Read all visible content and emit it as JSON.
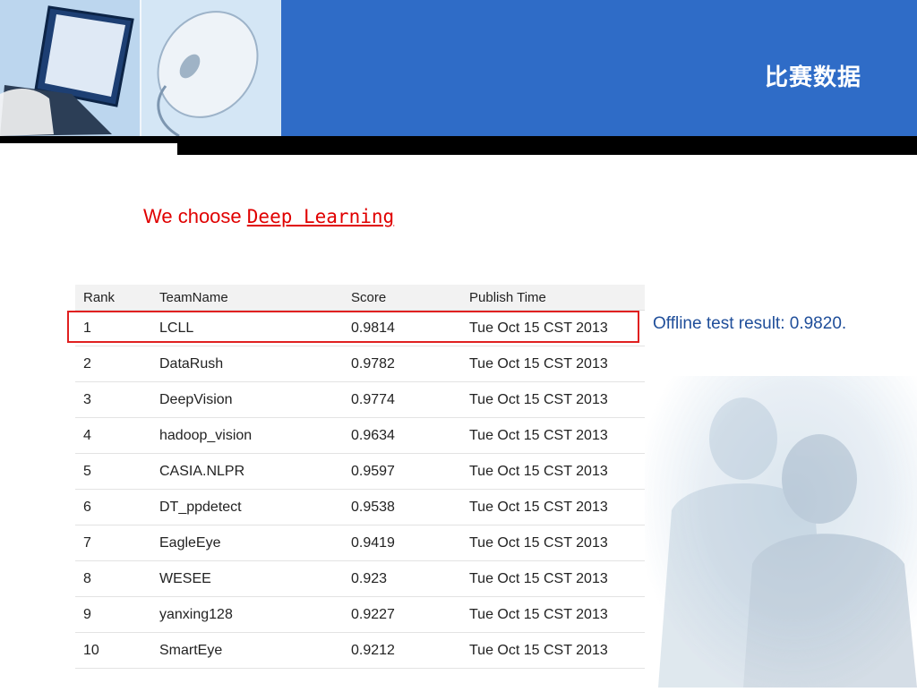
{
  "header": {
    "title": "比赛数据",
    "photo_left_desc": "laptop-photo",
    "photo_right_desc": "mouse-photo",
    "accent_color": "#2f6cc7"
  },
  "subtitle": {
    "prefix": "We choose ",
    "highlight": "Deep Learning",
    "color": "#e00000"
  },
  "leaderboard": {
    "columns": [
      "Rank",
      "TeamName",
      "Score",
      "Publish Time"
    ],
    "rows": [
      {
        "rank": "1",
        "team": "LCLL",
        "score": "0.9814",
        "time": "Tue Oct 15  CST 2013"
      },
      {
        "rank": "2",
        "team": "DataRush",
        "score": "0.9782",
        "time": "Tue Oct 15  CST 2013"
      },
      {
        "rank": "3",
        "team": "DeepVision",
        "score": "0.9774",
        "time": "Tue Oct 15  CST 2013"
      },
      {
        "rank": "4",
        "team": "hadoop_vision",
        "score": "0.9634",
        "time": "Tue Oct 15  CST 2013"
      },
      {
        "rank": "5",
        "team": "CASIA.NLPR",
        "score": "0.9597",
        "time": "Tue Oct 15  CST 2013"
      },
      {
        "rank": "6",
        "team": "DT_ppdetect",
        "score": "0.9538",
        "time": "Tue Oct 15  CST 2013"
      },
      {
        "rank": "7",
        "team": "EagleEye",
        "score": "0.9419",
        "time": "Tue Oct 15  CST 2013"
      },
      {
        "rank": "8",
        "team": "WESEE",
        "score": "0.923",
        "time": "Tue Oct 15  CST 2013"
      },
      {
        "rank": "9",
        "team": "yanxing128",
        "score": "0.9227",
        "time": "Tue Oct 15  CST 2013"
      },
      {
        "rank": "10",
        "team": "SmartEye",
        "score": "0.9212",
        "time": "Tue Oct 15  CST 2013"
      }
    ],
    "highlight_color": "#e02020"
  },
  "note": {
    "text": "Offline test result: 0.9820.",
    "color": "#1f4e9a"
  }
}
